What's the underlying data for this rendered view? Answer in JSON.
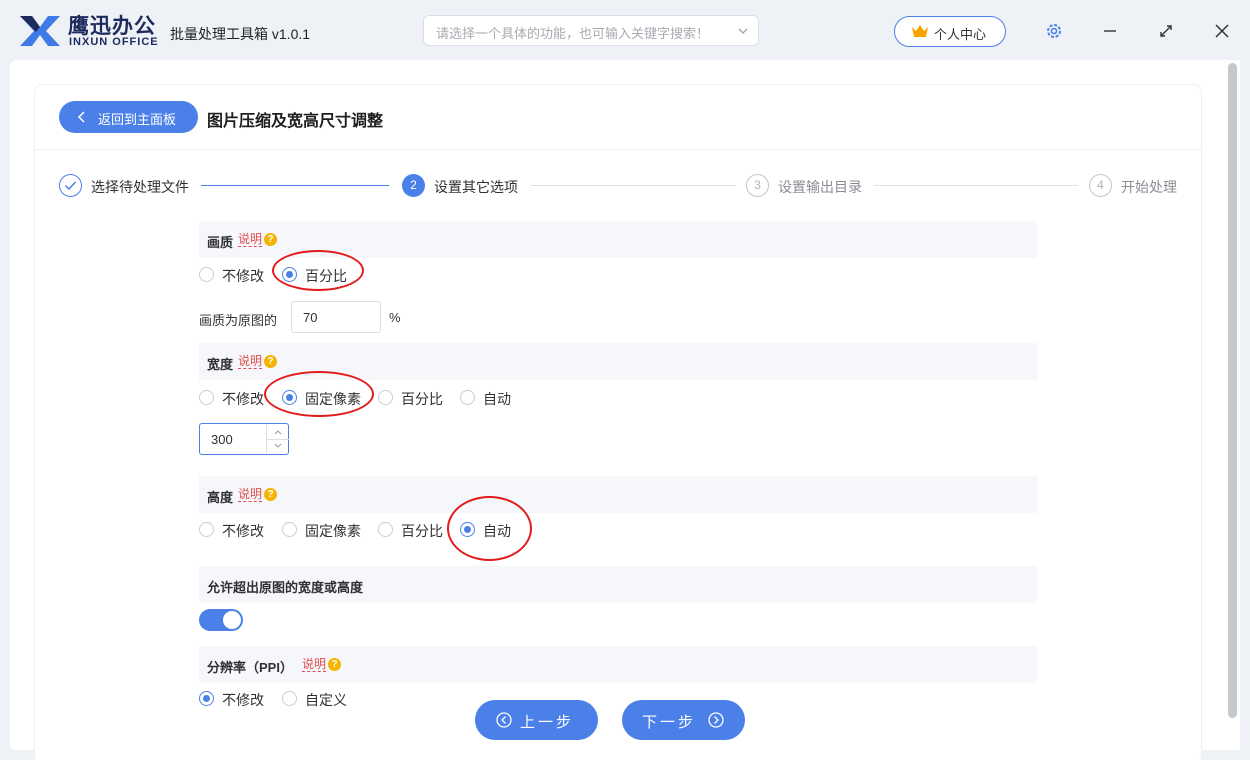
{
  "app": {
    "brand_cn": "鹰迅办公",
    "brand_en": "INXUN OFFICE",
    "title": "批量处理工具箱 v1.0.1",
    "search_placeholder": "请选择一个具体的功能，也可输入关键字搜索！",
    "user_center": "个人中心",
    "icons": [
      "logo-icon",
      "chevron-down-icon",
      "crown-icon",
      "gear-icon",
      "minimize-icon",
      "maximize-icon",
      "close-icon"
    ]
  },
  "page": {
    "back_label": "返回到主面板",
    "title": "图片压缩及宽高尺寸调整"
  },
  "steps": [
    {
      "num": "1",
      "label": "选择待处理文件",
      "state": "done"
    },
    {
      "num": "2",
      "label": "设置其它选项",
      "state": "active"
    },
    {
      "num": "3",
      "label": "设置输出目录",
      "state": "todo"
    },
    {
      "num": "4",
      "label": "开始处理",
      "state": "todo"
    }
  ],
  "quality": {
    "title": "画质",
    "help": "说明",
    "options": [
      "不修改",
      "百分比"
    ],
    "selected": "百分比",
    "field_label": "画质为原图的",
    "field_value": "70",
    "unit": "%"
  },
  "width": {
    "title": "宽度",
    "help": "说明",
    "options": [
      "不修改",
      "固定像素",
      "百分比",
      "自动"
    ],
    "selected": "固定像素",
    "value": "300"
  },
  "height": {
    "title": "高度",
    "help": "说明",
    "options": [
      "不修改",
      "固定像素",
      "百分比",
      "自动"
    ],
    "selected": "自动"
  },
  "allow_exceed": {
    "title": "允许超出原图的宽度或高度",
    "enabled": true
  },
  "resolution": {
    "title": "分辨率（PPI）",
    "help": "说明",
    "options": [
      "不修改",
      "自定义"
    ],
    "selected": "不修改"
  },
  "nav": {
    "prev": "上一步",
    "next": "下一步"
  },
  "colors": {
    "accent": "#4a80e8",
    "annotation": "#e21b1b",
    "help_text": "#e34d4d",
    "help_badge": "#f5b400"
  }
}
